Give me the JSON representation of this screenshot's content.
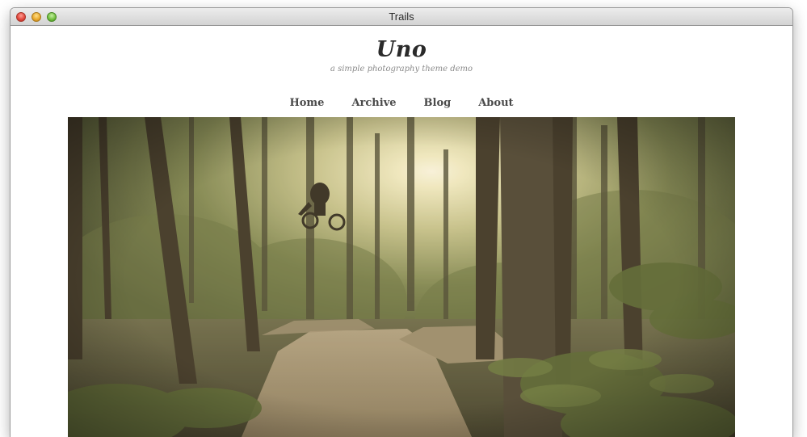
{
  "window": {
    "title": "Trails"
  },
  "site": {
    "title": "Uno",
    "tagline": "a simple photography theme demo"
  },
  "nav": {
    "items": [
      {
        "label": "Home"
      },
      {
        "label": "Archive"
      },
      {
        "label": "Blog"
      },
      {
        "label": "About"
      }
    ]
  },
  "colors": {
    "accent_text": "#2a2a2a",
    "nav_text": "#4a4a4a",
    "tagline_text": "#8a8a8a"
  }
}
